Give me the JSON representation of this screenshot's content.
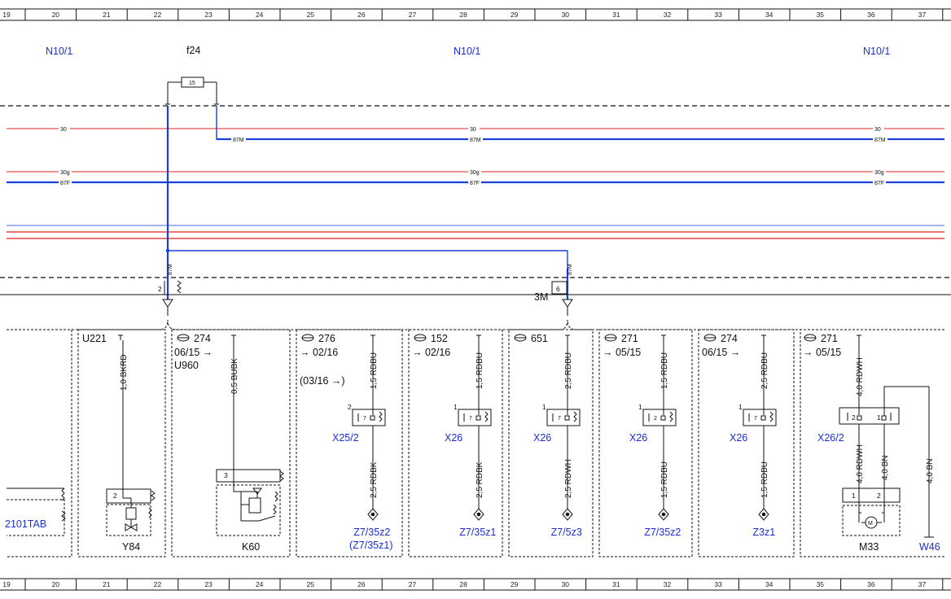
{
  "ruler": {
    "columns": [
      "19",
      "20",
      "21",
      "22",
      "23",
      "24",
      "25",
      "26",
      "27",
      "28",
      "29",
      "30",
      "31",
      "32",
      "33",
      "34",
      "35",
      "36",
      "37"
    ]
  },
  "colors": {
    "blue_wire": "#1a40d8",
    "red_wire": "#e02020",
    "light_blue_wire": "#6e86e8",
    "label_blue": "#1a2fd6",
    "line_black": "#111111"
  },
  "header": {
    "n10_left": "N10/1",
    "n10_mid": "N10/1",
    "n10_right": "N10/1",
    "fuse_ref": "f24",
    "fuse_value": "15"
  },
  "buses": {
    "b30": "30",
    "b87m": "87M",
    "b30g": "30g",
    "b87f": "87F"
  },
  "connectors": {
    "left_pin": "2",
    "left_wire": "87M",
    "right_pin": "6",
    "right_wire": "87M",
    "right_ref": "3M"
  },
  "modules": {
    "tab": {
      "label": "2101TAB"
    },
    "y84": {
      "header": "U221",
      "wire": "1,0 BKRD",
      "pin": "2",
      "component": "Y84"
    },
    "k60": {
      "code": "274",
      "date": "06/15 →",
      "sub": "U960",
      "wire": "0,5 BUBK",
      "pin": "3",
      "component": "K60"
    },
    "m276": {
      "code": "276",
      "date": "→ 02/16",
      "date2": "(03/16 →)",
      "wire_top": "1,5 RDBU",
      "plug_pin": "2",
      "inner_pin": "7",
      "connector": "X25/2",
      "wire_bottom": "2,5 RDBK",
      "ground": "Z7/35z2",
      "ground2": "(Z7/35z1)"
    },
    "m152": {
      "code": "152",
      "date": "→ 02/16",
      "wire_top": "1,5 RDBU",
      "plug_pin": "1",
      "inner_pin": "7",
      "connector": "X26",
      "wire_bottom": "2,5 RDBK",
      "ground": "Z7/35z1"
    },
    "m651": {
      "code": "651",
      "wire_top": "2,5 RDBU",
      "plug_pin": "1",
      "inner_pin": "7",
      "connector": "X26",
      "wire_bottom": "2,5 RDWH",
      "ground": "Z7/5z3"
    },
    "m271a": {
      "code": "271",
      "date": "→ 05/15",
      "wire_top": "1,5 RDBU",
      "plug_pin": "1",
      "inner_pin": "2",
      "connector": "X26",
      "wire_bottom": "1,5 RDBU",
      "ground": "Z7/35z2"
    },
    "m274": {
      "code": "274",
      "date": "06/15 →",
      "wire_top": "2,5 RDBU",
      "plug_pin": "1",
      "inner_pin": "7",
      "connector": "X26",
      "wire_bottom": "1,5 RDBU",
      "ground": "Z3z1"
    },
    "m271b": {
      "code": "271",
      "date": "→ 05/15",
      "wire_top": "4,0 RDWH",
      "plug_pin_a": "2",
      "plug_pin_b": "1",
      "connector": "X26/2",
      "wire_a": "4,0 RDWH",
      "wire_b": "4,0 BN",
      "motor_pin_a": "1",
      "motor_pin_b": "2",
      "motor_symbol": "M",
      "component": "M33",
      "wire_ext": "4,0 BN",
      "ext_component": "W46"
    }
  }
}
